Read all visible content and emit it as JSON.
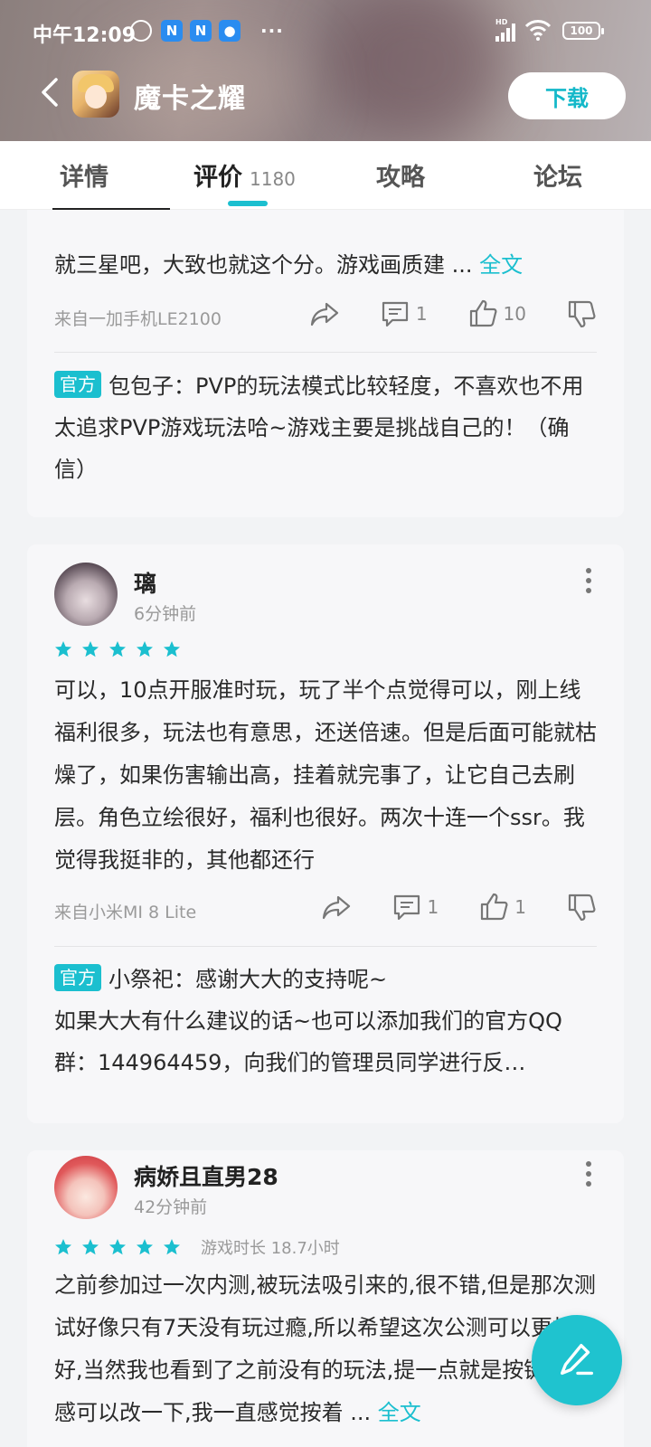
{
  "status_bar": {
    "time": "中午12:09",
    "battery": "100",
    "network": "HD",
    "notif_badge": "N",
    "more": "···"
  },
  "header": {
    "app_title": "魔卡之耀",
    "download_label": "下载"
  },
  "tabs": [
    {
      "label": "详情"
    },
    {
      "label": "评价",
      "count": "1180"
    },
    {
      "label": "攻略"
    },
    {
      "label": "论坛"
    }
  ],
  "reviews": [
    {
      "text": "就三星吧，大致也就这个分。游戏画质建 ... ",
      "more_label": "全文",
      "device": "来自一加手机LE2100",
      "comments": "1",
      "likes": "10",
      "reply": {
        "badge": "官方",
        "text": "包包子：PVP的玩法模式比较轻度，不喜欢也不用太追求PVP游戏玩法哈~游戏主要是挑战自己的！（确信）"
      }
    },
    {
      "username": "璃",
      "time": "6分钟前",
      "rating": 5,
      "text": "可以，10点开服准时玩，玩了半个点觉得可以，刚上线福利很多，玩法也有意思，还送倍速。但是后面可能就枯燥了，如果伤害输出高，挂着就完事了，让它自己去刷层。角色立绘很好，福利也很好。两次十连一个ssr。我觉得我挺非的，其他都还行",
      "device": "来自小米MI 8 Lite",
      "comments": "1",
      "likes": "1",
      "reply": {
        "badge": "官方",
        "line1": "小祭祀：感谢大大的支持呢~",
        "line2": "如果大大有什么建议的话~也可以添加我们的官方QQ群：144964459，向我们的管理员同学进行反…"
      }
    },
    {
      "username": "病娇且直男28",
      "time": "42分钟前",
      "rating": 5,
      "playtime": "游戏时长 18.7小时",
      "text": "之前参加过一次内测,被玩法吸引来的,很不错,但是那次测试好像只有7天没有玩过瘾,所以希望这次公测可以更加好,当然我也看到了之前没有的玩法,提一点就是按键的手感可以改一下,我一直感觉按着 ... ",
      "more_label": "全文"
    }
  ],
  "colors": {
    "accent": "#1bbfcf",
    "background": "#f2f3f5",
    "card": "#f7f7f9"
  }
}
